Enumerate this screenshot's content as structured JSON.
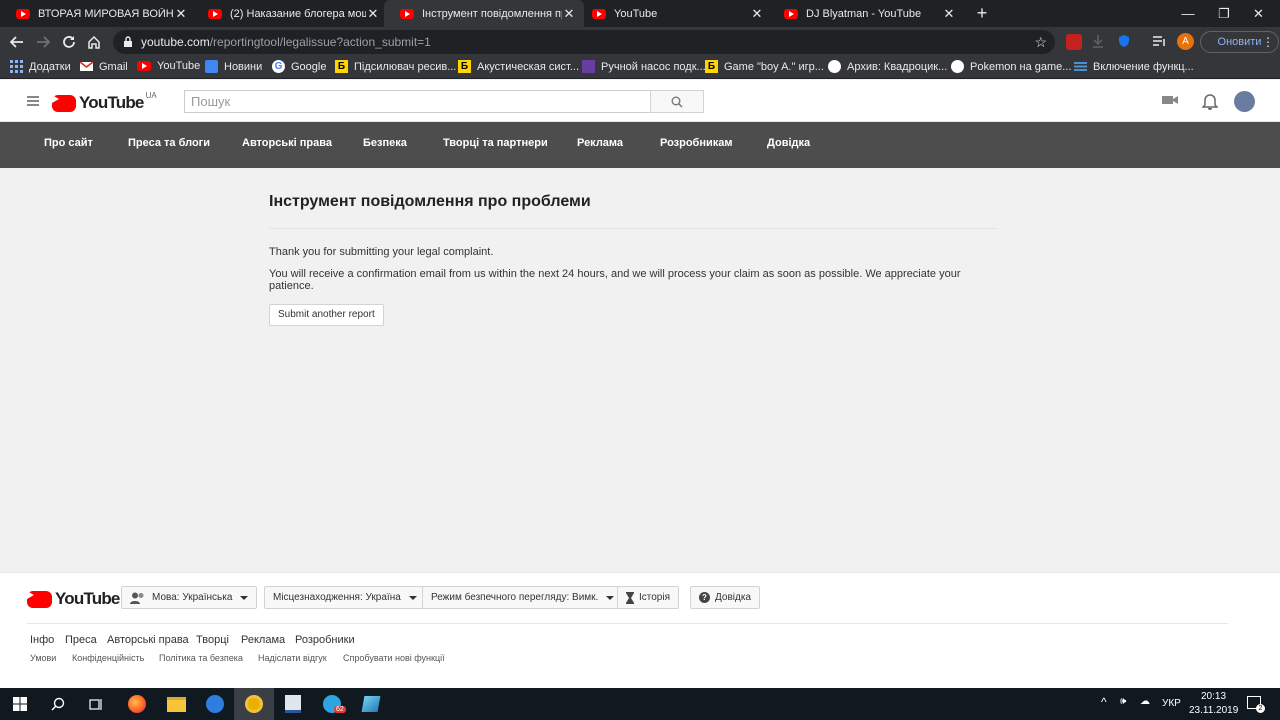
{
  "browser": {
    "tabs": [
      {
        "title": "ВТОРАЯ МИРОВАЯ ВОЙНА НА |",
        "active": false
      },
      {
        "title": "(2) Наказание блогера мошенн",
        "active": false
      },
      {
        "title": "Інструмент повідомлення про п",
        "active": true
      },
      {
        "title": "YouTube",
        "active": false
      },
      {
        "title": "DJ Blyatman - YouTube",
        "active": false
      }
    ],
    "url_host": "youtube.com",
    "url_path": "/reportingtool/legalissue?action_submit=1",
    "update_label": "Оновити",
    "profile_initial": "A",
    "bookmarks": [
      {
        "label": "Додатки",
        "icon": "apps-grid-icon"
      },
      {
        "label": "Gmail",
        "icon": "gmail-icon"
      },
      {
        "label": "YouTube",
        "icon": "youtube-icon"
      },
      {
        "label": "Новини",
        "icon": "news-icon"
      },
      {
        "label": "Google",
        "icon": "google-icon"
      },
      {
        "label": "Підсилювач ресив...",
        "icon": "b-store-icon"
      },
      {
        "label": "Акустическая сист...",
        "icon": "b-store-icon"
      },
      {
        "label": "Ручной насос подк...",
        "icon": "purple-square-icon"
      },
      {
        "label": "Game \"boy A.\" игр...",
        "icon": "b-store-icon"
      },
      {
        "label": "Архив: Квадроцик...",
        "icon": "olx-icon"
      },
      {
        "label": "Pokemon на game...",
        "icon": "olx-icon"
      },
      {
        "label": "Включение функц...",
        "icon": "blue-lines-icon"
      }
    ]
  },
  "youtube": {
    "logo_text": "YouTube",
    "region": "UA",
    "search_placeholder": "Пошук",
    "nav": [
      "Про сайт",
      "Преса та блоги",
      "Авторські права",
      "Безпека",
      "Творці та партнери",
      "Реклама",
      "Розробникам",
      "Довідка"
    ]
  },
  "main": {
    "title": "Інструмент повідомлення про проблеми",
    "line1": "Thank you for submitting your legal complaint.",
    "line2": "You will receive a confirmation email from us within the next 24 hours, and we will process your claim as soon as possible. We appreciate your patience.",
    "button": "Submit another report"
  },
  "footer": {
    "logo_text": "YouTube",
    "language_label": "Мова:",
    "language_value": "Українська",
    "location_label": "Місцезнаходження:",
    "location_value": "Україна",
    "safety_label": "Режим безпечного перегляду:",
    "safety_value": "Вимк.",
    "history": "Історія",
    "help": "Довідка",
    "links1": [
      "Інфо",
      "Преса",
      "Авторські права",
      "Творці",
      "Реклама",
      "Розробники"
    ],
    "links2": [
      "Умови",
      "Конфіденційність",
      "Політика та безпека",
      "Надіслати відгук",
      "Спробувати нові функції"
    ]
  },
  "taskbar": {
    "language": "УКР",
    "time": "20:13",
    "date": "23.11.2019",
    "notification_count": "2",
    "telegram_badge": "62"
  },
  "colors": {
    "youtube_red": "#ff0000",
    "nav_gray": "#4d4d4d",
    "chrome_dark": "#202124",
    "chrome_toolbar": "#35363a"
  }
}
